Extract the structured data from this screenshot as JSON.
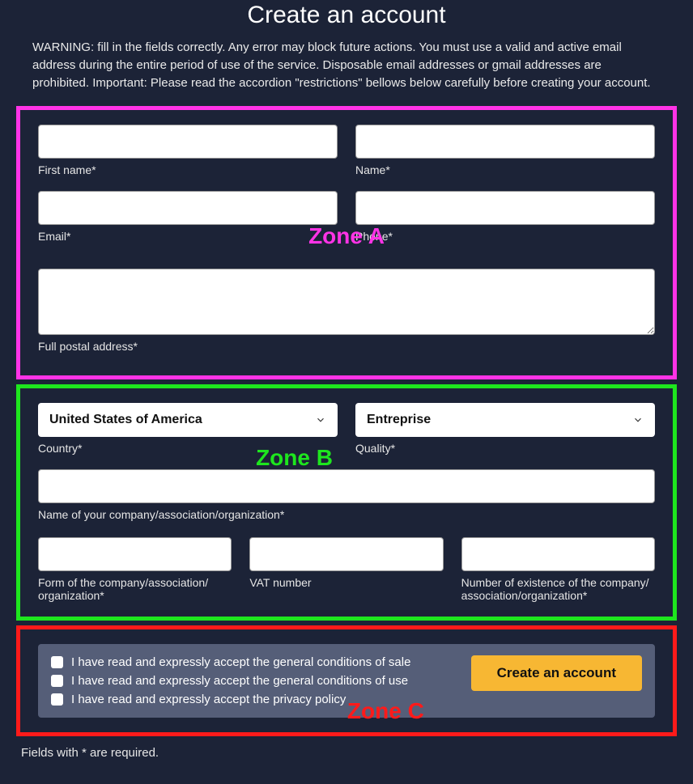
{
  "title": "Create an account",
  "warning": "WARNING: fill in the fields correctly. Any error may block future actions. You must use a valid and active email address during the entire period of use of the service. Disposable email addresses or gmail addresses are prohibited. Important: Please read the accordion \"restrictions\" bellows below carefully before creating your account.",
  "zoneA": {
    "label": "Zone A",
    "first_name_label": "First name*",
    "name_label": "Name*",
    "email_label": "Email*",
    "phone_label": "Phone*",
    "postal_label": "Full postal address*"
  },
  "zoneB": {
    "label": "Zone B",
    "country_value": "United States of America",
    "country_label": "Country*",
    "quality_value": "Entreprise",
    "quality_label": "Quality*",
    "company_name_label": "Name of your company/association/organization*",
    "company_form_label": "Form of the company/association/ organization*",
    "vat_label": "VAT number",
    "existence_label": "Number of existence of the company/ association/organization*"
  },
  "zoneC": {
    "label": "Zone C",
    "check1": "I have read and expressly accept the general conditions of sale",
    "check2": "I have read and expressly accept the general conditions of use",
    "check3": "I have read and expressly accept the privacy policy",
    "submit": "Create an account"
  },
  "footnote": "Fields with * are required."
}
